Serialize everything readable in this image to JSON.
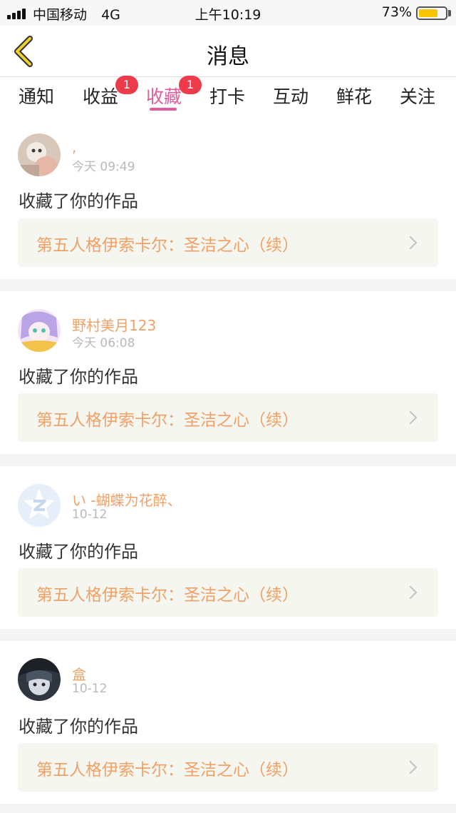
{
  "status_bar": {
    "carrier": "中国移动",
    "network": "4G",
    "time": "上午10:19",
    "battery_percent": "73%",
    "battery_level": 0.73
  },
  "nav": {
    "title": "消息",
    "back_icon": "chevron-left-icon"
  },
  "tabs": [
    {
      "label": "通知"
    },
    {
      "label": "收益",
      "badge": "1"
    },
    {
      "label": "收藏",
      "badge": "1",
      "active": true
    },
    {
      "label": "打卡"
    },
    {
      "label": "互动"
    },
    {
      "label": "鲜花"
    },
    {
      "label": "关注"
    }
  ],
  "messages": [
    {
      "username": ",",
      "time": "今天 09:49",
      "action": "收藏了你的作品",
      "work_title": "第五人格伊索卡尔：圣洁之心（续）"
    },
    {
      "username": "野村美月123",
      "time": "今天 06:08",
      "action": "收藏了你的作品",
      "work_title": "第五人格伊索卡尔：圣洁之心（续）"
    },
    {
      "username": "い -蝴蝶为花醉、",
      "time": "10-12",
      "action": "收藏了你的作品",
      "work_title": "第五人格伊索卡尔：圣洁之心（续）"
    },
    {
      "username": "盒",
      "time": "10-12",
      "action": "收藏了你的作品",
      "work_title": "第五人格伊索卡尔：圣洁之心（续）"
    }
  ],
  "colors": {
    "accent": "#e15c9b",
    "badge": "#ee3b4b",
    "username": "#f0a167",
    "work_title": "#f0a167",
    "back_icon": "#c9a600"
  }
}
